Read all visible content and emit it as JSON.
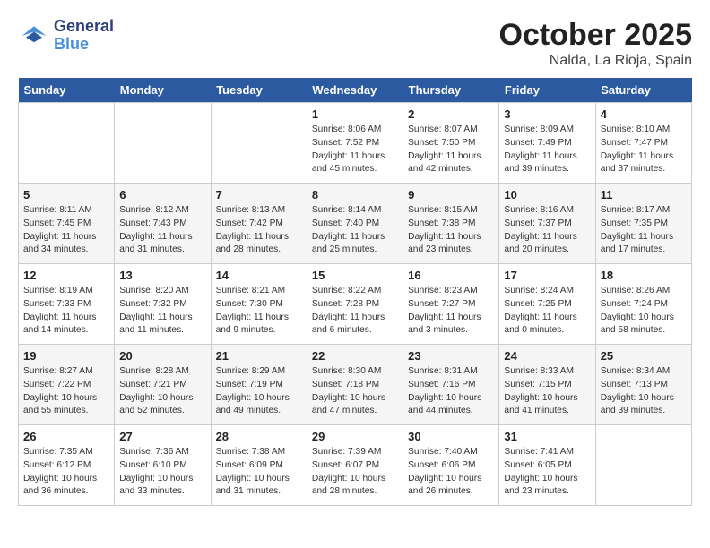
{
  "header": {
    "logo_line1": "General",
    "logo_line2": "Blue",
    "month": "October 2025",
    "location": "Nalda, La Rioja, Spain"
  },
  "days_of_week": [
    "Sunday",
    "Monday",
    "Tuesday",
    "Wednesday",
    "Thursday",
    "Friday",
    "Saturday"
  ],
  "weeks": [
    [
      {
        "day": "",
        "info": ""
      },
      {
        "day": "",
        "info": ""
      },
      {
        "day": "",
        "info": ""
      },
      {
        "day": "1",
        "info": "Sunrise: 8:06 AM\nSunset: 7:52 PM\nDaylight: 11 hours\nand 45 minutes."
      },
      {
        "day": "2",
        "info": "Sunrise: 8:07 AM\nSunset: 7:50 PM\nDaylight: 11 hours\nand 42 minutes."
      },
      {
        "day": "3",
        "info": "Sunrise: 8:09 AM\nSunset: 7:49 PM\nDaylight: 11 hours\nand 39 minutes."
      },
      {
        "day": "4",
        "info": "Sunrise: 8:10 AM\nSunset: 7:47 PM\nDaylight: 11 hours\nand 37 minutes."
      }
    ],
    [
      {
        "day": "5",
        "info": "Sunrise: 8:11 AM\nSunset: 7:45 PM\nDaylight: 11 hours\nand 34 minutes."
      },
      {
        "day": "6",
        "info": "Sunrise: 8:12 AM\nSunset: 7:43 PM\nDaylight: 11 hours\nand 31 minutes."
      },
      {
        "day": "7",
        "info": "Sunrise: 8:13 AM\nSunset: 7:42 PM\nDaylight: 11 hours\nand 28 minutes."
      },
      {
        "day": "8",
        "info": "Sunrise: 8:14 AM\nSunset: 7:40 PM\nDaylight: 11 hours\nand 25 minutes."
      },
      {
        "day": "9",
        "info": "Sunrise: 8:15 AM\nSunset: 7:38 PM\nDaylight: 11 hours\nand 23 minutes."
      },
      {
        "day": "10",
        "info": "Sunrise: 8:16 AM\nSunset: 7:37 PM\nDaylight: 11 hours\nand 20 minutes."
      },
      {
        "day": "11",
        "info": "Sunrise: 8:17 AM\nSunset: 7:35 PM\nDaylight: 11 hours\nand 17 minutes."
      }
    ],
    [
      {
        "day": "12",
        "info": "Sunrise: 8:19 AM\nSunset: 7:33 PM\nDaylight: 11 hours\nand 14 minutes."
      },
      {
        "day": "13",
        "info": "Sunrise: 8:20 AM\nSunset: 7:32 PM\nDaylight: 11 hours\nand 11 minutes."
      },
      {
        "day": "14",
        "info": "Sunrise: 8:21 AM\nSunset: 7:30 PM\nDaylight: 11 hours\nand 9 minutes."
      },
      {
        "day": "15",
        "info": "Sunrise: 8:22 AM\nSunset: 7:28 PM\nDaylight: 11 hours\nand 6 minutes."
      },
      {
        "day": "16",
        "info": "Sunrise: 8:23 AM\nSunset: 7:27 PM\nDaylight: 11 hours\nand 3 minutes."
      },
      {
        "day": "17",
        "info": "Sunrise: 8:24 AM\nSunset: 7:25 PM\nDaylight: 11 hours\nand 0 minutes."
      },
      {
        "day": "18",
        "info": "Sunrise: 8:26 AM\nSunset: 7:24 PM\nDaylight: 10 hours\nand 58 minutes."
      }
    ],
    [
      {
        "day": "19",
        "info": "Sunrise: 8:27 AM\nSunset: 7:22 PM\nDaylight: 10 hours\nand 55 minutes."
      },
      {
        "day": "20",
        "info": "Sunrise: 8:28 AM\nSunset: 7:21 PM\nDaylight: 10 hours\nand 52 minutes."
      },
      {
        "day": "21",
        "info": "Sunrise: 8:29 AM\nSunset: 7:19 PM\nDaylight: 10 hours\nand 49 minutes."
      },
      {
        "day": "22",
        "info": "Sunrise: 8:30 AM\nSunset: 7:18 PM\nDaylight: 10 hours\nand 47 minutes."
      },
      {
        "day": "23",
        "info": "Sunrise: 8:31 AM\nSunset: 7:16 PM\nDaylight: 10 hours\nand 44 minutes."
      },
      {
        "day": "24",
        "info": "Sunrise: 8:33 AM\nSunset: 7:15 PM\nDaylight: 10 hours\nand 41 minutes."
      },
      {
        "day": "25",
        "info": "Sunrise: 8:34 AM\nSunset: 7:13 PM\nDaylight: 10 hours\nand 39 minutes."
      }
    ],
    [
      {
        "day": "26",
        "info": "Sunrise: 7:35 AM\nSunset: 6:12 PM\nDaylight: 10 hours\nand 36 minutes."
      },
      {
        "day": "27",
        "info": "Sunrise: 7:36 AM\nSunset: 6:10 PM\nDaylight: 10 hours\nand 33 minutes."
      },
      {
        "day": "28",
        "info": "Sunrise: 7:38 AM\nSunset: 6:09 PM\nDaylight: 10 hours\nand 31 minutes."
      },
      {
        "day": "29",
        "info": "Sunrise: 7:39 AM\nSunset: 6:07 PM\nDaylight: 10 hours\nand 28 minutes."
      },
      {
        "day": "30",
        "info": "Sunrise: 7:40 AM\nSunset: 6:06 PM\nDaylight: 10 hours\nand 26 minutes."
      },
      {
        "day": "31",
        "info": "Sunrise: 7:41 AM\nSunset: 6:05 PM\nDaylight: 10 hours\nand 23 minutes."
      },
      {
        "day": "",
        "info": ""
      }
    ]
  ]
}
